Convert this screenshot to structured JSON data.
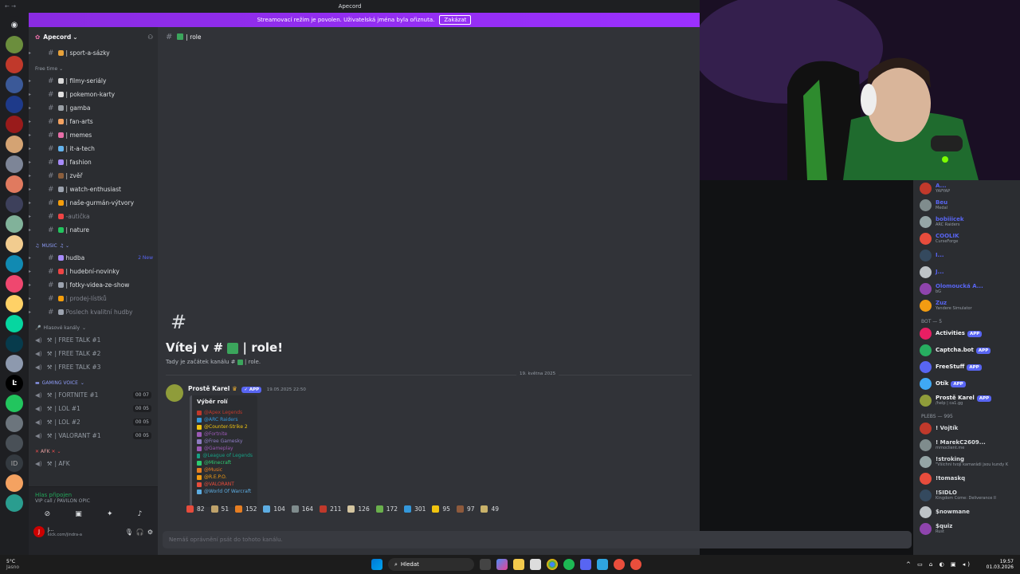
{
  "window": {
    "title": "Apecord",
    "nav": "←  →"
  },
  "banner": {
    "text": "Streamovací režim je povolen. Uživatelská jména byla ořiznuta.",
    "button": "Zakázat"
  },
  "server": {
    "name": "Apecord"
  },
  "channels_top": [
    {
      "label": "| sport-a-sázky",
      "color": "#e8a23a"
    }
  ],
  "cat_free": "Free time ⌄",
  "channels_free": [
    {
      "label": "| filmy-seriály",
      "color": "#d9d9d9"
    },
    {
      "label": "| pokemon-karty",
      "color": "#e0e0e0"
    },
    {
      "label": "| gamba",
      "color": "#9aa0a6"
    },
    {
      "label": "| fan-arts",
      "color": "#f4a261"
    },
    {
      "label": "| memes",
      "color": "#e86ea8"
    },
    {
      "label": "| it-a-tech",
      "color": "#63b3ed"
    },
    {
      "label": "| fashion",
      "color": "#a78bfa"
    },
    {
      "label": "| zvěř",
      "color": "#8b5e3c"
    },
    {
      "label": "| watch-enthusiast",
      "color": "#9ca3af"
    },
    {
      "label": "| naše-gurmán-výtvory",
      "color": "#f59e0b"
    },
    {
      "label": "-autička",
      "color": "#ef4444",
      "muted": true
    },
    {
      "label": "| nature",
      "color": "#22c55e"
    }
  ],
  "cat_music": "MUSIC",
  "channels_music": [
    {
      "label": "hudba",
      "color": "#a78bfa",
      "badge": "2 New"
    },
    {
      "label": "| hudební-novinky",
      "color": "#ef4444"
    },
    {
      "label": "| fotky-videa-ze-show",
      "color": "#9ca3af"
    },
    {
      "label": "| prodej-lístků",
      "color": "#f59e0b",
      "muted": true
    },
    {
      "label": "Poslech kvalitní hudby",
      "color": "#9ca3af",
      "muted": true
    }
  ],
  "cat_voice": "Hlasové kanály",
  "voice_free": [
    "| FREE TALK #1",
    "| FREE TALK #2",
    "| FREE TALK #3"
  ],
  "cat_gaming": "GAMING VOICE",
  "voice_gaming": [
    {
      "label": "| FORTNITE #1",
      "count": "00 07"
    },
    {
      "label": "| LOL #1",
      "count": "00 05"
    },
    {
      "label": "| LOL #2",
      "count": "00 05"
    },
    {
      "label": "| VALORANT #1",
      "count": "00 05"
    }
  ],
  "cat_afk": "AFK",
  "voice_afk": [
    "| AFK"
  ],
  "voicebar": {
    "status": "Hlas připojen",
    "sub": "VIP call / PAVILON OPIC",
    "user": "J...",
    "user_sub": "kick.com/jindra-a"
  },
  "channel": {
    "name": "| role",
    "welcome": "Vítej v #",
    "welcome_end": "| role!",
    "sub": "Tady je začátek kanálu #",
    "sub_end": "| role."
  },
  "date_sep": "19. května 2025",
  "message": {
    "author": "Prostě Karel",
    "badge": "APP",
    "time": "19.05.2025 22:50",
    "embed_title": "Výběr rolí",
    "roles": [
      {
        "label": "@Apex Legends",
        "color": "#c0392b"
      },
      {
        "label": "@ARC Raiders",
        "color": "#3498db"
      },
      {
        "label": "@Counter-Strike 2",
        "color": "#f1c40f"
      },
      {
        "label": "@Fortnite",
        "color": "#9b59b6"
      },
      {
        "label": "@Free Gamesky",
        "color": "#8e7cc3"
      },
      {
        "label": "@Gameplay",
        "color": "#9b59b6"
      },
      {
        "label": "@League of Legends",
        "color": "#16a085"
      },
      {
        "label": "@Minecraft",
        "color": "#2ecc71"
      },
      {
        "label": "@Music",
        "color": "#e67e22"
      },
      {
        "label": "@R.E.P.O.",
        "color": "#f39c12"
      },
      {
        "label": "@VALORANT",
        "color": "#e74c3c"
      },
      {
        "label": "@World Of Warcraft",
        "color": "#5dade2"
      }
    ]
  },
  "reactions": [
    {
      "n": "82",
      "color": "#e74c3c"
    },
    {
      "n": "51",
      "color": "#bfa36b"
    },
    {
      "n": "152",
      "color": "#e67e22"
    },
    {
      "n": "104",
      "color": "#5dade2"
    },
    {
      "n": "164",
      "color": "#7f8c8d"
    },
    {
      "n": "211",
      "color": "#c0392b"
    },
    {
      "n": "126",
      "color": "#d4c5a0"
    },
    {
      "n": "172",
      "color": "#6ab04c"
    },
    {
      "n": "301",
      "color": "#3498db"
    },
    {
      "n": "95",
      "color": "#f1c40f"
    },
    {
      "n": "97",
      "color": "#8e5a3c"
    },
    {
      "n": "49",
      "color": "#c9b26a"
    }
  ],
  "input_placeholder": "Nemáš oprávnění psát do tohoto kanálu.",
  "members_top": [
    {
      "name": "A...",
      "sub": "YAPYAP",
      "color": "#5865f2"
    },
    {
      "name": "Beu",
      "sub": "Medal",
      "color": "#5865f2"
    },
    {
      "name": "bobiiicek",
      "sub": "ARC Raiders",
      "color": "#5865f2"
    },
    {
      "name": "COOLIK",
      "sub": "CurseForge",
      "color": "#5865f2"
    },
    {
      "name": "I...",
      "sub": "",
      "color": "#5865f2"
    },
    {
      "name": "J...",
      "sub": "",
      "color": "#5865f2"
    },
    {
      "name": "Olomoucká A...",
      "sub": "bG",
      "color": "#5865f2"
    },
    {
      "name": "Zuz",
      "sub": "Yandere Simulator",
      "color": "#5865f2"
    }
  ],
  "cat_bot": "BOT — 5",
  "bots": [
    {
      "name": "Activities",
      "badge": "APP",
      "color": "#e91e63"
    },
    {
      "name": "Captcha.bot",
      "badge": "APP",
      "color": "#27ae60"
    },
    {
      "name": "FreeStuff",
      "badge": "APP",
      "color": "#5865f2"
    },
    {
      "name": "Otík",
      "badge": "APP",
      "color": "#3fa9f5"
    },
    {
      "name": "Prostě Karel",
      "badge": "APP",
      "sub": "/help | ca1.gg",
      "color": "#8f9c3a"
    }
  ],
  "cat_plebs": "PLEBS — 995",
  "plebs": [
    {
      "name": "! Vojtík",
      "sub": "",
      "color": "#dbdee1"
    },
    {
      "name": "! MarekC2609...",
      "sub": "mrnoclient.me",
      "color": "#dbdee1"
    },
    {
      "name": "!stroking",
      "sub": "\"Všichni tvoji kamarádi jsou kundy K",
      "color": "#dbdee1"
    },
    {
      "name": "!tomaskq",
      "sub": "",
      "color": "#dbdee1"
    },
    {
      "name": "!SIDLO",
      "sub": "Kingdom Come: Deliverance II",
      "color": "#dbdee1"
    },
    {
      "name": "$nowmane",
      "sub": "",
      "color": "#dbdee1"
    },
    {
      "name": "$quiz",
      "sub": "Rust",
      "color": "#dbdee1"
    }
  ],
  "taskbar": {
    "weather": "5°C",
    "weather_sub": "Jasno",
    "search": "Hledat",
    "time": "19:57",
    "date": "01.03.2026"
  }
}
